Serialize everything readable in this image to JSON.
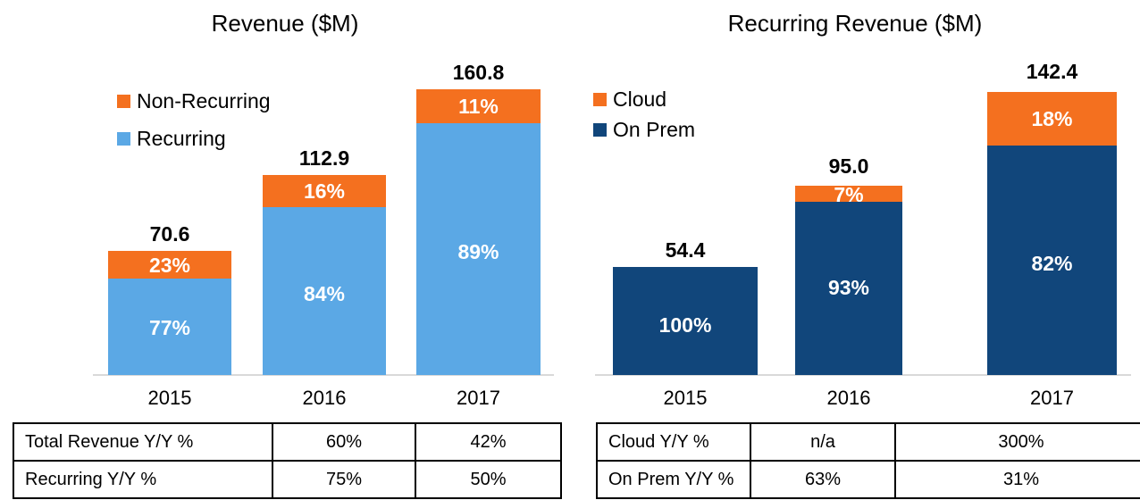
{
  "chart_data": [
    {
      "type": "bar",
      "subtype": "stacked-bar-percent",
      "title": "Revenue ($M)",
      "xlabel": "",
      "ylabel": "",
      "grid": false,
      "legend_position": "upper-left-inside",
      "categories": [
        "2015",
        "2016",
        "2017"
      ],
      "totals": [
        "70.6",
        "112.9",
        "160.8"
      ],
      "totals_numeric": [
        70.6,
        112.9,
        160.8
      ],
      "ylim": [
        0,
        180
      ],
      "series": [
        {
          "name": "Non-Recurring",
          "color": "#F4701F",
          "values": [
            23,
            16,
            11
          ],
          "labels": [
            "23%",
            "16%",
            "11%"
          ]
        },
        {
          "name": "Recurring",
          "color": "#5BA8E5",
          "values": [
            77,
            84,
            89
          ],
          "labels": [
            "77%",
            "84%",
            "89%"
          ]
        }
      ],
      "table": {
        "rows": [
          {
            "label": "Total Revenue Y/Y %",
            "values": [
              "",
              "60%",
              "42%"
            ]
          },
          {
            "label": "Recurring Y/Y %",
            "values": [
              "",
              "75%",
              "50%"
            ]
          }
        ]
      }
    },
    {
      "type": "bar",
      "subtype": "stacked-bar-percent",
      "title": "Recurring Revenue ($M)",
      "xlabel": "",
      "ylabel": "",
      "grid": false,
      "legend_position": "upper-left-inside",
      "categories": [
        "2015",
        "2016",
        "2017"
      ],
      "totals": [
        "54.4",
        "95.0",
        "142.4"
      ],
      "totals_numeric": [
        54.4,
        95.0,
        142.4
      ],
      "ylim": [
        0,
        180
      ],
      "series": [
        {
          "name": "Cloud",
          "color": "#F4701F",
          "values": [
            0,
            7,
            18
          ],
          "labels": [
            "",
            "7%",
            "18%"
          ]
        },
        {
          "name": "On Prem",
          "color": "#11467B",
          "values": [
            100,
            93,
            82
          ],
          "labels": [
            "100%",
            "93%",
            "82%"
          ]
        }
      ],
      "table": {
        "rows": [
          {
            "label": "Cloud Y/Y %",
            "values": [
              "",
              "n/a",
              "300%"
            ]
          },
          {
            "label": "On Prem Y/Y %",
            "values": [
              "",
              "63%",
              "31%"
            ]
          }
        ]
      }
    }
  ],
  "left": {
    "title": "Revenue ($M)",
    "legend": [
      {
        "label": "Non-Recurring",
        "color": "#F4701F"
      },
      {
        "label": "Recurring",
        "color": "#5BA8E5"
      }
    ],
    "bars": [
      {
        "category": "2015",
        "total": "70.6",
        "top": {
          "label": "23%",
          "color": "#F4701F"
        },
        "bottom": {
          "label": "77%",
          "color": "#5BA8E5"
        }
      },
      {
        "category": "2016",
        "total": "112.9",
        "top": {
          "label": "16%",
          "color": "#F4701F"
        },
        "bottom": {
          "label": "84%",
          "color": "#5BA8E5"
        }
      },
      {
        "category": "2017",
        "total": "160.8",
        "top": {
          "label": "11%",
          "color": "#F4701F"
        },
        "bottom": {
          "label": "89%",
          "color": "#5BA8E5"
        }
      }
    ],
    "table": {
      "row1": {
        "head": "Total Revenue Y/Y %",
        "c2016": "60%",
        "c2017": "42%"
      },
      "row2": {
        "head": "Recurring Y/Y %",
        "c2016": "75%",
        "c2017": "50%"
      }
    }
  },
  "right": {
    "title": "Recurring Revenue ($M)",
    "legend": [
      {
        "label": "Cloud",
        "color": "#F4701F"
      },
      {
        "label": "On Prem",
        "color": "#11467B"
      }
    ],
    "bars": [
      {
        "category": "2015",
        "total": "54.4",
        "top": {
          "label": "",
          "color": "#F4701F"
        },
        "bottom": {
          "label": "100%",
          "color": "#11467B"
        }
      },
      {
        "category": "2016",
        "total": "95.0",
        "top": {
          "label": "7%",
          "color": "#F4701F"
        },
        "bottom": {
          "label": "93%",
          "color": "#11467B"
        }
      },
      {
        "category": "2017",
        "total": "142.4",
        "top": {
          "label": "18%",
          "color": "#F4701F"
        },
        "bottom": {
          "label": "82%",
          "color": "#11467B"
        }
      }
    ],
    "table": {
      "row1": {
        "head": "Cloud Y/Y %",
        "c2016": "n/a",
        "c2017": "300%"
      },
      "row2": {
        "head": "On Prem Y/Y %",
        "c2016": "63%",
        "c2017": "31%"
      }
    }
  },
  "colors": {
    "orange": "#F4701F",
    "light_blue": "#5BA8E5",
    "navy": "#11467B",
    "axis": "#D9D9D9",
    "table_border": "#000000",
    "text": "#000000",
    "bar_label_text": "#FFFFFF"
  }
}
